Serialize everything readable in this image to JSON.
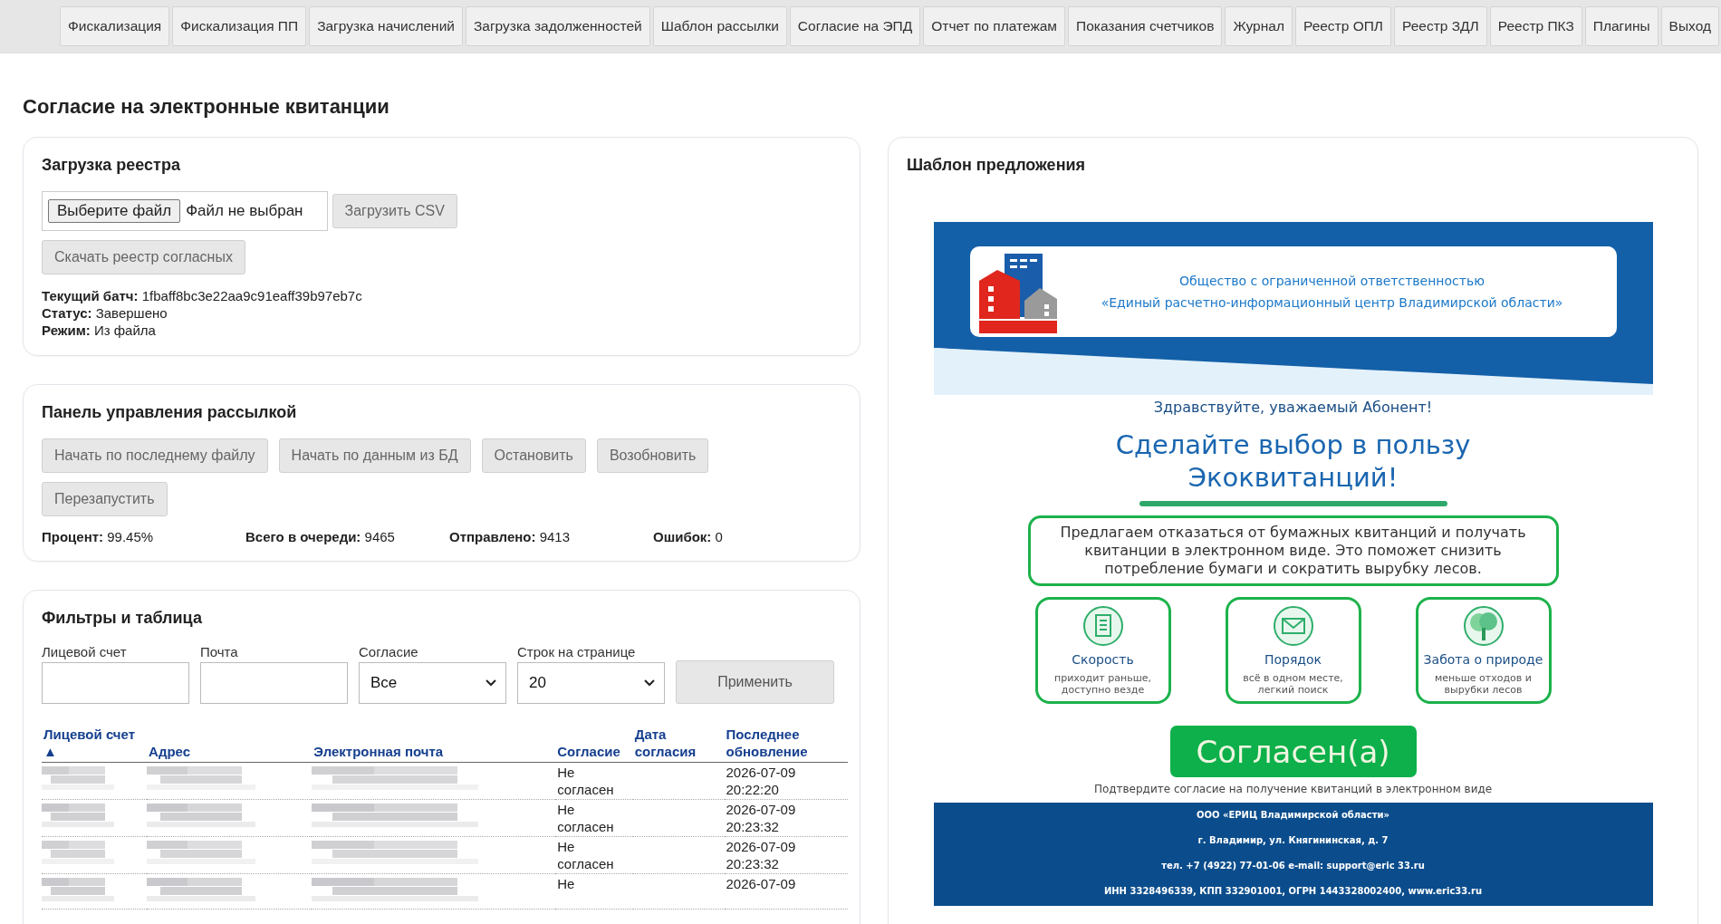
{
  "nav": [
    "Фискализация",
    "Фискализация ПП",
    "Загрузка начислений",
    "Загрузка задолженностей",
    "Шаблон рассылки",
    "Согласие на ЭПД",
    "Отчет по платежам",
    "Показания счетчиков",
    "Журнал",
    "Реестр ОПЛ",
    "Реестр ЗДЛ",
    "Реестр ПКЗ",
    "Плагины",
    "Выход"
  ],
  "page_title": "Согласие на электронные квитанции",
  "upload": {
    "title": "Загрузка реестра",
    "file_button": "Выберите файл",
    "file_value": "Файл не выбран",
    "upload_button": "Загрузить CSV",
    "download_button": "Скачать реестр согласных",
    "info": [
      {
        "label": "Текущий батч:",
        "value": "1fbaff8bc3e22aa9c91eaff39b97eb7c"
      },
      {
        "label": "Статус:",
        "value": "Завершено"
      },
      {
        "label": "Режим:",
        "value": "Из файла"
      }
    ]
  },
  "mailing": {
    "title": "Панель управления рассылкой",
    "buttons": [
      "Начать по последнему файлу",
      "Начать по данным из БД",
      "Остановить",
      "Возобновить",
      "Перезапустить"
    ],
    "stats": [
      {
        "label": "Процент:",
        "value": "99.45%"
      },
      {
        "label": "Всего в очереди:",
        "value": "9465"
      },
      {
        "label": "Отправлено:",
        "value": "9413"
      },
      {
        "label": "Ошибок:",
        "value": "0"
      }
    ]
  },
  "filters": {
    "title": "Фильтры и таблица",
    "fields": [
      {
        "label": "Лицевой счет",
        "kind": "text"
      },
      {
        "label": "Почта",
        "kind": "text"
      },
      {
        "label": "Согласие",
        "kind": "select",
        "value": "Все"
      },
      {
        "label": "Строк на странице",
        "kind": "select",
        "value": "20"
      }
    ],
    "apply_button": "Применить"
  },
  "table": {
    "columns": [
      "Лицевой счет ▲",
      "Адрес",
      "Электронная почта",
      "Согласие",
      "Дата согласия",
      "Последнее обновление"
    ],
    "rows": [
      {
        "consent": "Не согласен",
        "updated": "2026-07-09 20:22:20"
      },
      {
        "consent": "Не согласен",
        "updated": "2026-07-09 20:23:32"
      },
      {
        "consent": "Не согласен",
        "updated": "2026-07-09 20:23:32"
      },
      {
        "consent": "Не",
        "updated": "2026-07-09"
      }
    ]
  },
  "template": {
    "title": "Шаблон предложения",
    "org_lines": [
      "Общество с ограниченной ответственностью",
      "«Единый расчетно-информационный центр Владимирской области»"
    ],
    "greeting": "Здравствуйте, уважаемый Абонент!",
    "headline": "Сделайте выбор в пользу Экоквитанций!",
    "intro": "Предлагаем отказаться от бумажных квитанций и получать квитанции в электронном виде. Это поможет снизить потребление бумаги и сократить вырубку лесов.",
    "features": [
      {
        "kind": "document",
        "title": "Скорость",
        "text": "приходит раньше, доступно везде"
      },
      {
        "kind": "envelope",
        "title": "Порядок",
        "text": "всё в одном месте, легкий поиск"
      },
      {
        "kind": "tree",
        "title": "Забота о природе",
        "text": "меньше отходов и вырубки лесов"
      }
    ],
    "agree_button": "Согласен(а)",
    "caption": "Подтвердите согласие на получение квитанций в электронном виде",
    "footer": [
      "ООО «ЕРИЦ Владимирской области»",
      "г. Владимир, ул. Княгининская, д. 7",
      "тел. +7 (4922) 77-01-06 e-mail: support@eric 33.ru",
      "ИНН 3328496339, КПП 332901001, ОГРН 1443328002400, www.eric33.ru"
    ]
  }
}
